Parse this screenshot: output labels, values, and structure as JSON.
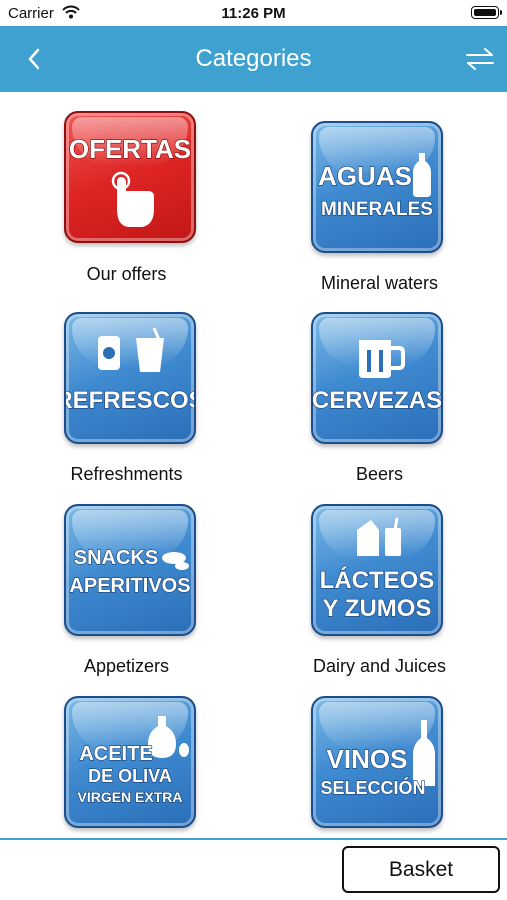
{
  "status_bar": {
    "carrier": "Carrier",
    "time": "11:26 PM"
  },
  "header": {
    "title": "Categories"
  },
  "categories": [
    {
      "tile_text": [
        "OFERTAS"
      ],
      "label": "Our offers",
      "color": "red"
    },
    {
      "tile_text": [
        "AGUAS",
        "MINERALES"
      ],
      "label": "Mineral waters",
      "color": "blue"
    },
    {
      "tile_text": [
        "REFRESCOS"
      ],
      "label": "Refreshments",
      "color": "blue"
    },
    {
      "tile_text": [
        "CERVEZAS"
      ],
      "label": "Beers",
      "color": "blue"
    },
    {
      "tile_text": [
        "SNACKS",
        "APERITIVOS"
      ],
      "label": "Appetizers",
      "color": "blue"
    },
    {
      "tile_text": [
        "LÁCTEOS",
        "Y ZUMOS"
      ],
      "label": "Dairy and Juices",
      "color": "blue"
    },
    {
      "tile_text": [
        "ACEITE",
        "DE OLIVA",
        "VIRGEN EXTRA"
      ],
      "label": "",
      "color": "blue"
    },
    {
      "tile_text": [
        "VINOS",
        "SELECCIÓN"
      ],
      "label": "",
      "color": "blue"
    }
  ],
  "footer": {
    "basket_label": "Basket"
  },
  "colors": {
    "nav": "#3fa1cf",
    "tile_blue": "#3f8ad0",
    "tile_red": "#dd2424"
  }
}
